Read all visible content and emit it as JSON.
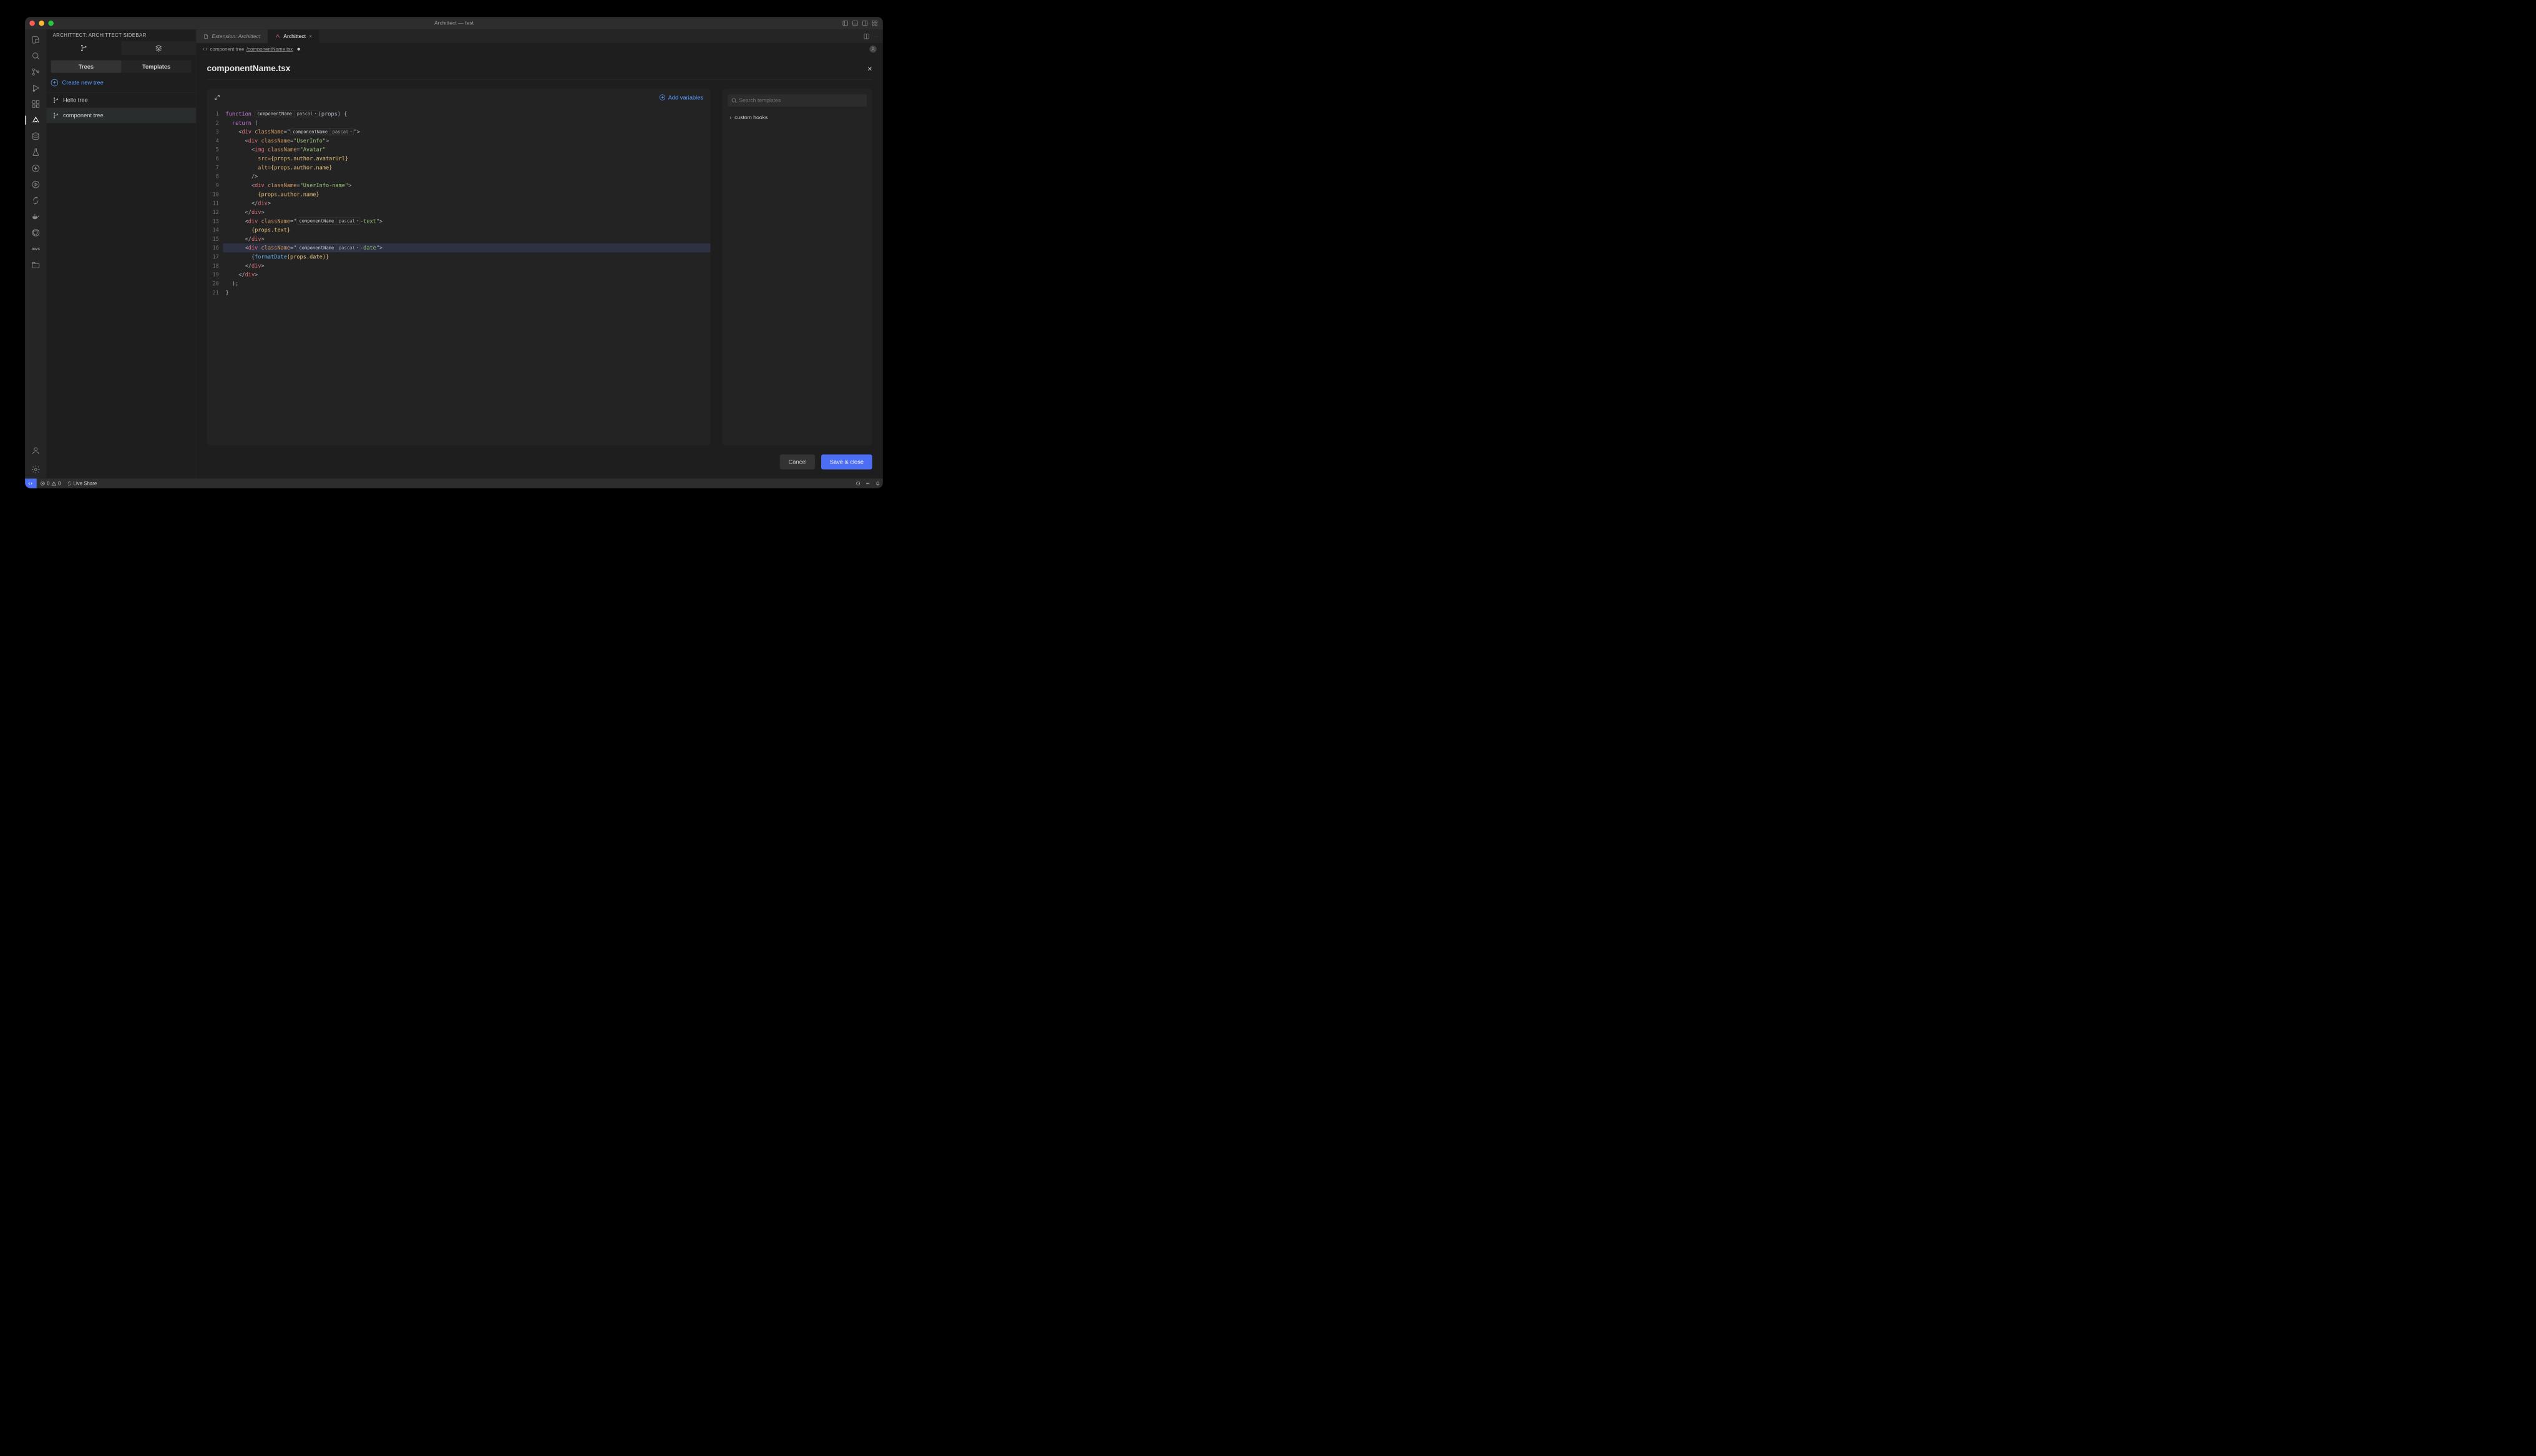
{
  "window": {
    "title": "Archittect — test"
  },
  "sidebar": {
    "title": "ARCHITTECT: ARCHITTECT SIDEBAR",
    "innerTabs": {
      "trees": "Trees",
      "templates": "Templates"
    },
    "create": "Create new tree",
    "items": [
      {
        "label": "Hello tree"
      },
      {
        "label": "component tree"
      }
    ]
  },
  "editorTabs": {
    "ext": "Extension: Archittect",
    "arch": "Archittect"
  },
  "breadcrumb": {
    "seg1": "component tree",
    "seg2": "/componentName.tsx"
  },
  "file": {
    "title": "componentName.tsx"
  },
  "codeToolbar": {
    "addVars": "Add variables"
  },
  "varChip": {
    "name": "componentName",
    "type": "pascal"
  },
  "searchTemplates": {
    "placeholder": "Search templates"
  },
  "sideItems": {
    "customHooks": "custom hooks"
  },
  "buttons": {
    "cancel": "Cancel",
    "save": "Save & close"
  },
  "statusbar": {
    "errors": "0",
    "warnings": "0",
    "liveShare": "Live Share"
  },
  "lineNumbers": [
    "1",
    "2",
    "3",
    "4",
    "5",
    "6",
    "7",
    "8",
    "9",
    "10",
    "11",
    "12",
    "13",
    "14",
    "15",
    "16",
    "17",
    "18",
    "19",
    "20",
    "21"
  ],
  "codeStrings": {
    "props": "(props) {",
    "return": "return",
    "paren": "(",
    "userinfo": "UserInfo",
    "avatar": "Avatar",
    "src": "src=",
    "srcVal": "{props.author.avatarUrl}",
    "alt": "alt=",
    "altVal": "{props.author.name}",
    "userinfoName": "UserInfo-name",
    "authorName": "{props.author.name}",
    "text": "-text",
    "propsText": "{props.text}",
    "date": "-date",
    "fmtOpen": "{",
    "fmt": "formatDate",
    "fmtArgs": "(props.date)}",
    "closeParen": ");",
    "closeBrace": "}"
  }
}
